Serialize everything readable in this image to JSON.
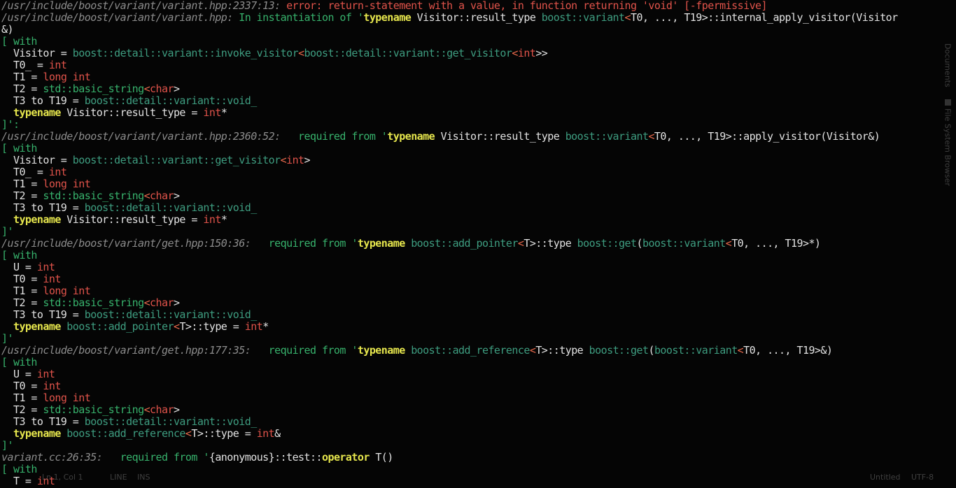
{
  "sidebar": {
    "tabs": [
      {
        "label": "Documents"
      },
      {
        "label": "File System Browser"
      }
    ]
  },
  "statusbar": {
    "line_col": "Ln 1, Col 1",
    "mode": "LINE",
    "insert_mode": "INS",
    "filename": "Untitled",
    "encoding": "UTF-8"
  },
  "lines": [
    [
      [
        "pl",
        "/usr/include/boost/variant/variant.hpp:2337:13: "
      ],
      [
        "r",
        "error: return-statement with a value, in function returning 'void' [-fpermissive]"
      ]
    ],
    [
      [
        "pl",
        "/usr/include/boost/variant/variant.hpp: "
      ],
      [
        "g",
        "In instantiation of '"
      ],
      [
        "y",
        "typename"
      ],
      [
        "w",
        " Visitor::result_type "
      ],
      [
        "b",
        "boost::variant"
      ],
      [
        "o",
        "<"
      ],
      [
        "w",
        "T0, ..., T19>::internal_apply_visitor(Visitor"
      ]
    ],
    [
      [
        "w",
        "&)"
      ]
    ],
    [
      [
        "g",
        "[ with"
      ]
    ],
    [
      [
        "w",
        "  Visitor = "
      ],
      [
        "b",
        "boost::detail::variant::invoke_visitor"
      ],
      [
        "o",
        "<"
      ],
      [
        "b",
        "boost::detail::variant::get_visitor"
      ],
      [
        "o",
        "<"
      ],
      [
        "r",
        "int"
      ],
      [
        "w",
        ">>"
      ]
    ],
    [
      [
        "w",
        "  T0_ = "
      ],
      [
        "r",
        "int"
      ]
    ],
    [
      [
        "w",
        "  T1 = "
      ],
      [
        "r",
        "long int"
      ]
    ],
    [
      [
        "w",
        "  T2 = "
      ],
      [
        "g",
        "std::basic_string"
      ],
      [
        "o",
        "<"
      ],
      [
        "r",
        "char"
      ],
      [
        "w",
        ">"
      ]
    ],
    [
      [
        "w",
        "  T3 to T19 = "
      ],
      [
        "b",
        "boost::detail::variant::void_"
      ]
    ],
    [
      [
        "y",
        "  typename"
      ],
      [
        "w",
        " Visitor::result_type = "
      ],
      [
        "r",
        "int"
      ],
      [
        "w",
        "*"
      ]
    ],
    [
      [
        "g",
        "]':"
      ]
    ],
    [
      [
        "pl",
        "/usr/include/boost/variant/variant.hpp:2360:52:   "
      ],
      [
        "g",
        "required from '"
      ],
      [
        "y",
        "typename"
      ],
      [
        "w",
        " Visitor::result_type "
      ],
      [
        "b",
        "boost::variant"
      ],
      [
        "o",
        "<"
      ],
      [
        "w",
        "T0, ..., T19>::apply_visitor(Visitor&)"
      ]
    ],
    [
      [
        "g",
        "[ with"
      ]
    ],
    [
      [
        "w",
        "  Visitor = "
      ],
      [
        "b",
        "boost::detail::variant::get_visitor"
      ],
      [
        "o",
        "<"
      ],
      [
        "r",
        "int"
      ],
      [
        "w",
        ">"
      ]
    ],
    [
      [
        "w",
        "  T0_ = "
      ],
      [
        "r",
        "int"
      ]
    ],
    [
      [
        "w",
        "  T1 = "
      ],
      [
        "r",
        "long int"
      ]
    ],
    [
      [
        "w",
        "  T2 = "
      ],
      [
        "g",
        "std::basic_string"
      ],
      [
        "o",
        "<"
      ],
      [
        "r",
        "char"
      ],
      [
        "w",
        ">"
      ]
    ],
    [
      [
        "w",
        "  T3 to T19 = "
      ],
      [
        "b",
        "boost::detail::variant::void_"
      ]
    ],
    [
      [
        "y",
        "  typename"
      ],
      [
        "w",
        " Visitor::result_type = "
      ],
      [
        "r",
        "int"
      ],
      [
        "w",
        "*"
      ]
    ],
    [
      [
        "g",
        "]'"
      ]
    ],
    [
      [
        "pl",
        "/usr/include/boost/variant/get.hpp:150:36:   "
      ],
      [
        "g",
        "required from '"
      ],
      [
        "y",
        "typename"
      ],
      [
        "b",
        " boost::add_pointer"
      ],
      [
        "o",
        "<"
      ],
      [
        "w",
        "T>::type "
      ],
      [
        "b",
        "boost::get"
      ],
      [
        "w",
        "("
      ],
      [
        "b",
        "boost::variant"
      ],
      [
        "o",
        "<"
      ],
      [
        "w",
        "T0, ..., T19>*)"
      ]
    ],
    [
      [
        "g",
        "[ with"
      ]
    ],
    [
      [
        "w",
        "  U = "
      ],
      [
        "r",
        "int"
      ]
    ],
    [
      [
        "w",
        "  T0 = "
      ],
      [
        "r",
        "int"
      ]
    ],
    [
      [
        "w",
        "  T1 = "
      ],
      [
        "r",
        "long int"
      ]
    ],
    [
      [
        "w",
        "  T2 = "
      ],
      [
        "g",
        "std::basic_string"
      ],
      [
        "o",
        "<"
      ],
      [
        "r",
        "char"
      ],
      [
        "w",
        ">"
      ]
    ],
    [
      [
        "w",
        "  T3 to T19 = "
      ],
      [
        "b",
        "boost::detail::variant::void_"
      ]
    ],
    [
      [
        "y",
        "  typename"
      ],
      [
        "b",
        " boost::add_pointer"
      ],
      [
        "o",
        "<"
      ],
      [
        "w",
        "T>::type = "
      ],
      [
        "r",
        "int"
      ],
      [
        "w",
        "*"
      ]
    ],
    [
      [
        "g",
        "]'"
      ]
    ],
    [
      [
        "pl",
        "/usr/include/boost/variant/get.hpp:177:35:   "
      ],
      [
        "g",
        "required from '"
      ],
      [
        "y",
        "typename"
      ],
      [
        "b",
        " boost::add_reference"
      ],
      [
        "o",
        "<"
      ],
      [
        "w",
        "T>::type "
      ],
      [
        "b",
        "boost::get"
      ],
      [
        "w",
        "("
      ],
      [
        "b",
        "boost::variant"
      ],
      [
        "o",
        "<"
      ],
      [
        "w",
        "T0, ..., T19>&)"
      ]
    ],
    [
      [
        "g",
        "[ with"
      ]
    ],
    [
      [
        "w",
        "  U = "
      ],
      [
        "r",
        "int"
      ]
    ],
    [
      [
        "w",
        "  T0 = "
      ],
      [
        "r",
        "int"
      ]
    ],
    [
      [
        "w",
        "  T1 = "
      ],
      [
        "r",
        "long int"
      ]
    ],
    [
      [
        "w",
        "  T2 = "
      ],
      [
        "g",
        "std::basic_string"
      ],
      [
        "o",
        "<"
      ],
      [
        "r",
        "char"
      ],
      [
        "w",
        ">"
      ]
    ],
    [
      [
        "w",
        "  T3 to T19 = "
      ],
      [
        "b",
        "boost::detail::variant::void_"
      ]
    ],
    [
      [
        "y",
        "  typename"
      ],
      [
        "b",
        " boost::add_reference"
      ],
      [
        "o",
        "<"
      ],
      [
        "w",
        "T>::type = "
      ],
      [
        "r",
        "int"
      ],
      [
        "w",
        "&"
      ]
    ],
    [
      [
        "g",
        "]'"
      ]
    ],
    [
      [
        "pl",
        "variant.cc:26:35:   "
      ],
      [
        "g",
        "required from '"
      ],
      [
        "w",
        "{anonymous}::test::"
      ],
      [
        "y",
        "operator"
      ],
      [
        "w",
        " T()"
      ]
    ],
    [
      [
        "g",
        "[ with"
      ]
    ],
    [
      [
        "w",
        "  T = "
      ],
      [
        "r",
        "int"
      ]
    ]
  ]
}
